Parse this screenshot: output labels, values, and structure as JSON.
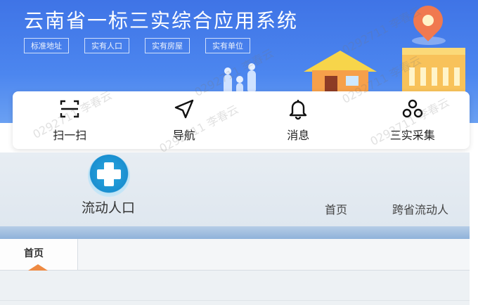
{
  "app": {
    "title": "云南省一标三实综合应用系统",
    "tags": [
      "标准地址",
      "实有人口",
      "实有房屋",
      "实有单位"
    ],
    "quick_actions": [
      {
        "label": "扫一扫",
        "icon": "scan-icon"
      },
      {
        "label": "导航",
        "icon": "navigation-arrow-icon"
      },
      {
        "label": "消息",
        "icon": "bell-icon"
      },
      {
        "label": "三实采集",
        "icon": "collect-icon"
      }
    ]
  },
  "web": {
    "logo_text": "流动人口",
    "nav": {
      "home": "首页",
      "cross_province": "跨省流动人"
    },
    "tab_active": "首页"
  },
  "watermark": "0292711 李春云",
  "colors": {
    "banner": "#4c86ef",
    "accent": "#ee8a43"
  }
}
